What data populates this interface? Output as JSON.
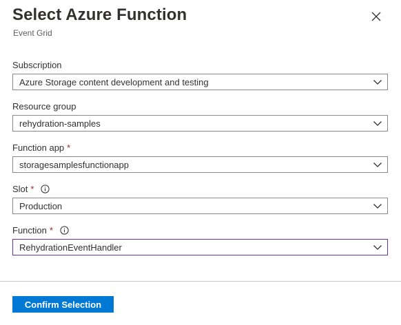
{
  "header": {
    "title": "Select Azure Function",
    "subtitle": "Event Grid",
    "close_icon": "close-icon"
  },
  "fields": {
    "subscription": {
      "label": "Subscription",
      "value": "Azure Storage content development and testing",
      "required": false
    },
    "resource_group": {
      "label": "Resource group",
      "value": "rehydration-samples",
      "required": false
    },
    "function_app": {
      "label": "Function app",
      "value": "storagesamplesfunctionapp",
      "required_mark": "*"
    },
    "slot": {
      "label": "Slot",
      "value": "Production",
      "required_mark": "*",
      "info_icon": "info-icon"
    },
    "function": {
      "label": "Function",
      "value": "RehydrationEventHandler",
      "required_mark": "*",
      "info_icon": "info-icon"
    }
  },
  "footer": {
    "confirm_label": "Confirm Selection"
  },
  "colors": {
    "primary": "#0078d4",
    "required": "#a4262c",
    "focus_border": "#6b2fa4",
    "divider": "#c8c6c4"
  }
}
